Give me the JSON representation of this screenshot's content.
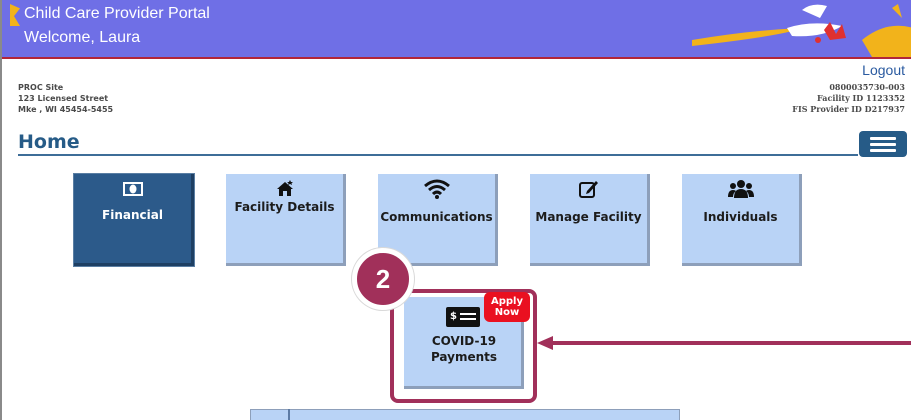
{
  "header": {
    "title": "Child Care Provider Portal",
    "welcome": "Welcome, Laura"
  },
  "account": {
    "logout_label": "Logout",
    "site_name": "PROC Site",
    "street": "123 Licensed Street",
    "city": "Mke , WI 45454-5455",
    "provider_number": "0800035730-003",
    "facility_id": "Facility ID 1123352",
    "fis_provider_id": "FIS Provider ID D217937"
  },
  "page": {
    "title": "Home"
  },
  "tiles": [
    {
      "label": "Financial",
      "icon": "money-icon",
      "active": true
    },
    {
      "label": "Facility Details",
      "icon": "house-icon",
      "active": false
    },
    {
      "label": "Communications",
      "icon": "wifi-icon",
      "active": false
    },
    {
      "label": "Manage Facility",
      "icon": "edit-icon",
      "active": false
    },
    {
      "label": "Individuals",
      "icon": "users-icon",
      "active": false
    }
  ],
  "covid_tile": {
    "icon_text": "$",
    "label_line1": "COVID-19",
    "label_line2": "Payments",
    "badge_line1": "Apply",
    "badge_line2": "Now"
  },
  "annotation": {
    "step_number": "2"
  },
  "colors": {
    "banner": "#6f6fe6",
    "tile": "#b9d3f6",
    "tile_active": "#2c5a8a",
    "highlight": "#a1305a",
    "badge": "#ea1020",
    "title": "#265b87"
  }
}
